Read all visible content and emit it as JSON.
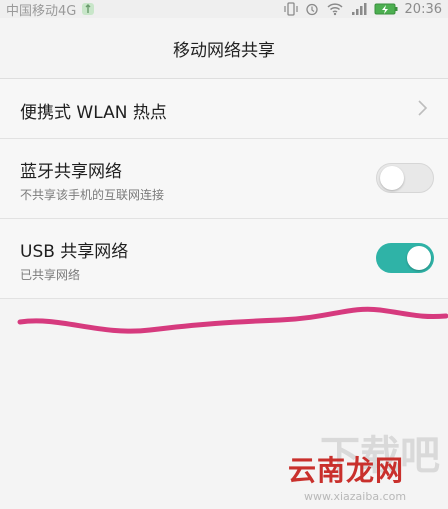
{
  "status_bar": {
    "carrier": "中国移动4G",
    "time": "20:36",
    "icons": [
      "usb-icon",
      "vibrate-icon",
      "alarm-icon",
      "wifi-icon",
      "signal-icon",
      "battery-charging-icon"
    ]
  },
  "header": {
    "title": "移动网络共享"
  },
  "settings": [
    {
      "title": "便携式 WLAN 热点",
      "control": "chevron"
    },
    {
      "title": "蓝牙共享网络",
      "subtitle": "不共享该手机的互联网连接",
      "control": "toggle",
      "state": "off"
    },
    {
      "title": "USB 共享网络",
      "subtitle": "已共享网络",
      "control": "toggle",
      "state": "on"
    }
  ],
  "colors": {
    "toggle_on": "#2fb3a7",
    "annotation": "#d63a7e"
  },
  "watermark": {
    "text": "云南龙网",
    "url": "www.xiazaiba.com",
    "big_text": "下载吧"
  }
}
